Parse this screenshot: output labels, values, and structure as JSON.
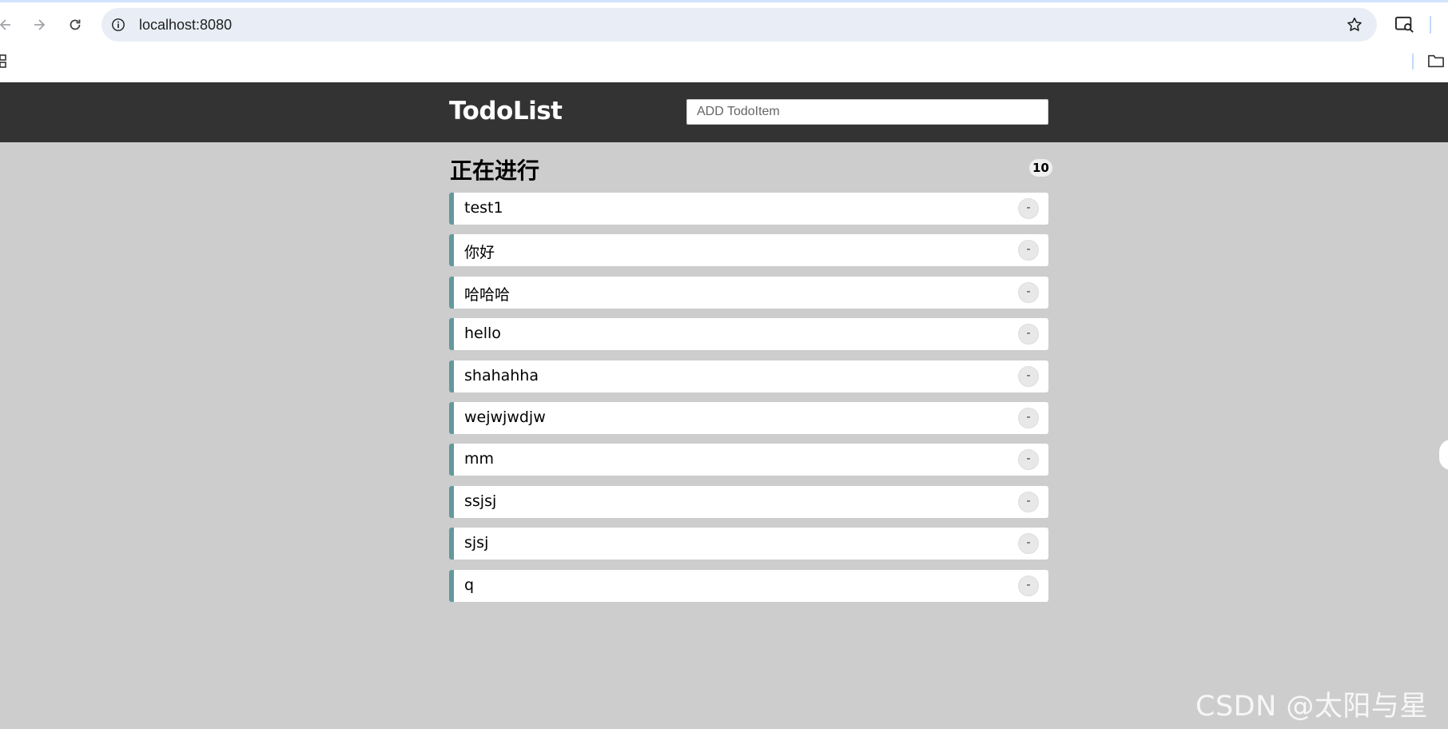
{
  "browser": {
    "url": "localhost:8080"
  },
  "app": {
    "title": "TodoList",
    "add_placeholder": "ADD TodoItem",
    "add_value": ""
  },
  "section": {
    "title": "正在进行",
    "count": "10"
  },
  "todos": [
    {
      "label": "test1",
      "delete_label": "-"
    },
    {
      "label": "你好",
      "delete_label": "-"
    },
    {
      "label": "哈哈哈",
      "delete_label": "-"
    },
    {
      "label": "hello",
      "delete_label": "-"
    },
    {
      "label": "shahahha",
      "delete_label": "-"
    },
    {
      "label": "wejwjwdjw",
      "delete_label": "-"
    },
    {
      "label": "mm",
      "delete_label": "-"
    },
    {
      "label": "ssjsj",
      "delete_label": "-"
    },
    {
      "label": "sjsj",
      "delete_label": "-"
    },
    {
      "label": "q",
      "delete_label": "-"
    }
  ],
  "watermark": "CSDN @太阳与星辰",
  "colors": {
    "header_bg": "#333333",
    "page_bg": "#cdcdcd",
    "item_accent": "#629a9c"
  },
  "icons": {
    "back": "back-arrow-icon",
    "forward": "forward-arrow-icon",
    "reload": "reload-icon",
    "site_info": "info-icon",
    "bookmark": "star-icon",
    "lens": "lens-icon",
    "apps": "apps-grid-icon",
    "folder": "folder-icon"
  }
}
